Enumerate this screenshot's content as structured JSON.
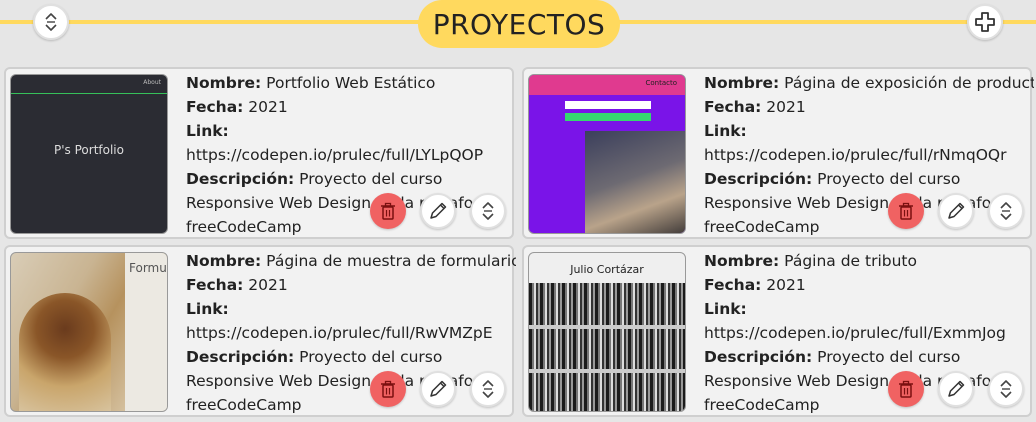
{
  "header": {
    "title": "PROYECTOS",
    "sort_icon": "sort-up-down-icon",
    "add_icon": "plus-icon",
    "accent_color": "#ffd95e"
  },
  "labels": {
    "name": "Nombre:",
    "date": "Fecha:",
    "link": "Link:",
    "description": "Descripción:"
  },
  "projects": [
    {
      "name": "Portfolio Web Estático",
      "date": "2021",
      "link": "https://codepen.io/prulec/full/LYLpQOP",
      "description": "Proyecto del curso Responsive Web Design de la plataforma freeCodeCamp",
      "thumb": {
        "title": "P's Portfolio",
        "nav": "About"
      }
    },
    {
      "name": "Página de exposición de producto",
      "date": "2021",
      "link": "https://codepen.io/prulec/full/rNmqOQr",
      "description": "Proyecto del curso Responsive Web Design de la plataforma freeCodeCamp",
      "thumb": {
        "nav": "Contacto"
      }
    },
    {
      "name": "Página de muestra de formulario",
      "date": "2021",
      "link": "https://codepen.io/prulec/full/RwVMZpE",
      "description": "Proyecto del curso Responsive Web Design de la plataforma freeCodeCamp",
      "thumb": {
        "title": "Formula"
      }
    },
    {
      "name": "Página de tributo",
      "date": "2021",
      "link": "https://codepen.io/prulec/full/ExmmJog",
      "description": "Proyecto del curso Responsive Web Design de la plataforma freeCodeCamp",
      "thumb": {
        "title": "Julio Cortázar"
      }
    }
  ],
  "actions": {
    "delete_icon": "trash-icon",
    "edit_icon": "pencil-icon",
    "sort_icon": "sort-up-down-icon",
    "delete_color": "#f06262"
  }
}
